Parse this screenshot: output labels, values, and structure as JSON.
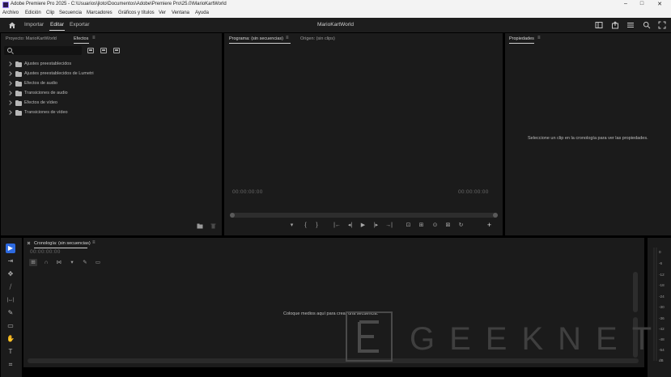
{
  "window": {
    "title": "Adobe Premiere Pro 2025 - C:\\Usuarios\\jloto\\Documentos\\Adobe\\Premiere Pro\\25.0\\MarioKartWorld",
    "controls": [
      "–",
      "□",
      "✕"
    ]
  },
  "menu": [
    "Archivo",
    "Edición",
    "Clip",
    "Secuencia",
    "Marcadores",
    "Gráficos y títulos",
    "Ver",
    "Ventana",
    "Ayuda"
  ],
  "header": {
    "tabs": [
      "Importar",
      "Editar",
      "Exportar"
    ],
    "active_tab": "Editar",
    "project_name": "MarioKartWorld"
  },
  "project_panel": {
    "tabs": [
      "Proyecto: MarioKartWorld",
      "Efectos"
    ],
    "menu_glyph": "≡",
    "tree": [
      "Ajustes preestablecidos",
      "Ajustes preestablecidos de Lumetri",
      "Efectos de audio",
      "Transiciones de audio",
      "Efectos de vídeo",
      "Transiciones de vídeo"
    ]
  },
  "program_panel": {
    "tabs": [
      "Programa: (sin secuencias)",
      "Origen: (sin clips)"
    ],
    "timecode_left": "00:00:00:00",
    "timecode_right": "00:00:00:00",
    "transport": [
      "▾",
      "{",
      "}",
      "|←",
      "◂|",
      "▶",
      "|▸",
      "→|",
      "⊡",
      "⊞",
      "⊙",
      "⊠",
      "↻",
      "+"
    ]
  },
  "properties_panel": {
    "tab": "Propiedades",
    "empty_message": "Seleccione un clip en la cronología para ver las propiedades."
  },
  "timeline_panel": {
    "tab": "Cronología: (sin secuencias)",
    "timecode": "00:00:00:00",
    "empty_message": "Coloque medios aquí para crear una secuencia."
  },
  "tools": [
    "▶",
    "⇥",
    "✥",
    "⧸",
    "|↔|",
    "✎",
    "▭",
    "✋",
    "T",
    "⌗"
  ],
  "meter": {
    "labels": [
      "0",
      "-6",
      "-12",
      "-18",
      "-24",
      "-30",
      "-36",
      "-42",
      "-48",
      "-54",
      "dB"
    ]
  },
  "watermark": {
    "text": "GEEKNETIC"
  },
  "colors": {
    "accent": "#2d6ae0",
    "panel": "#1b1b1b",
    "chrome": "#f3f3f3"
  }
}
